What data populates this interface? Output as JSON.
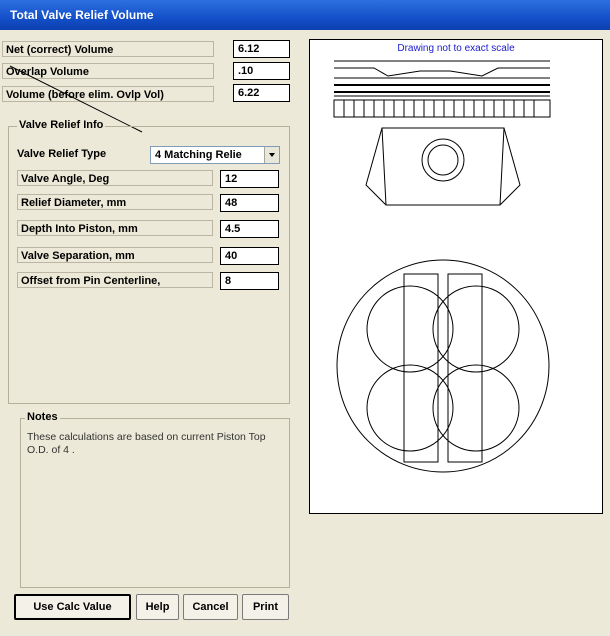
{
  "window": {
    "title": "Total Valve Relief Volume"
  },
  "volumes": {
    "net_label": "Net (correct) Volume",
    "net_value": "6.12",
    "overlap_label": "Overlap Volume",
    "overlap_value": ".10",
    "before_label": "Volume (before elim. Ovlp Vol)",
    "before_value": "6.22"
  },
  "valve_relief": {
    "legend": "Valve Relief Info",
    "type_label": "Valve Relief Type",
    "type_value": "4 Matching Relie",
    "angle_label": "Valve Angle, Deg",
    "angle_value": "12",
    "diameter_label": "Relief Diameter, mm",
    "diameter_value": "48",
    "depth_label": "Depth Into Piston, mm",
    "depth_value": "4.5",
    "separation_label": "Valve Separation, mm",
    "separation_value": "40",
    "offset_label": "Offset from Pin Centerline,",
    "offset_value": "8"
  },
  "notes": {
    "legend": "Notes",
    "text": "These calculations are based on current Piston Top O.D. of 4 ."
  },
  "buttons": {
    "use_calc": "Use Calc Value",
    "help": "Help",
    "cancel": "Cancel",
    "print": "Print"
  },
  "drawing": {
    "caption": "Drawing not to exact scale"
  }
}
